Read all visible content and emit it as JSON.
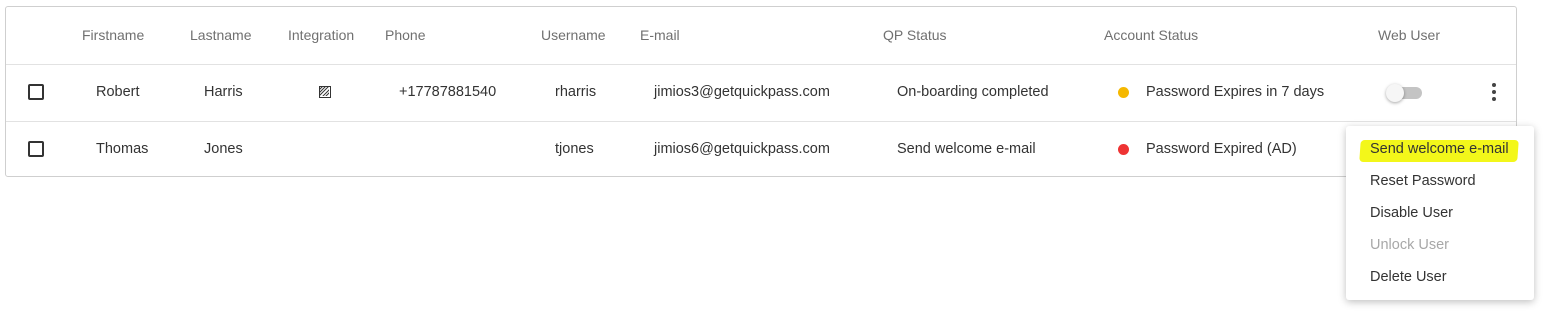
{
  "table": {
    "headers": {
      "firstname": "Firstname",
      "lastname": "Lastname",
      "integration": "Integration",
      "phone": "Phone",
      "username": "Username",
      "email": "E-mail",
      "qp_status": "QP Status",
      "account_status": "Account Status",
      "web_user": "Web User"
    },
    "rows": [
      {
        "firstname": "Robert",
        "lastname": "Harris",
        "integration_icon": "integration-icon",
        "phone": "+17787881540",
        "username": "rharris",
        "email": "jimios3@getquickpass.com",
        "qp_status": "On-boarding completed",
        "account_status": "Password Expires in 7 days",
        "status_color": "#f5b800",
        "web_user": false
      },
      {
        "firstname": "Thomas",
        "lastname": "Jones",
        "phone": "",
        "username": "tjones",
        "email": "jimios6@getquickpass.com",
        "qp_status": "Send welcome e-mail",
        "account_status": "Password Expired (AD)",
        "status_color": "#ee3333"
      }
    ]
  },
  "context_menu": {
    "items": [
      {
        "label": "Send welcome e-mail",
        "highlighted": true
      },
      {
        "label": "Reset Password"
      },
      {
        "label": "Disable User"
      },
      {
        "label": "Unlock User",
        "disabled": true
      },
      {
        "label": "Delete User"
      }
    ],
    "highlight_color": "#f3f71a"
  },
  "icons": {
    "row_actions": "more-vertical-icon"
  }
}
